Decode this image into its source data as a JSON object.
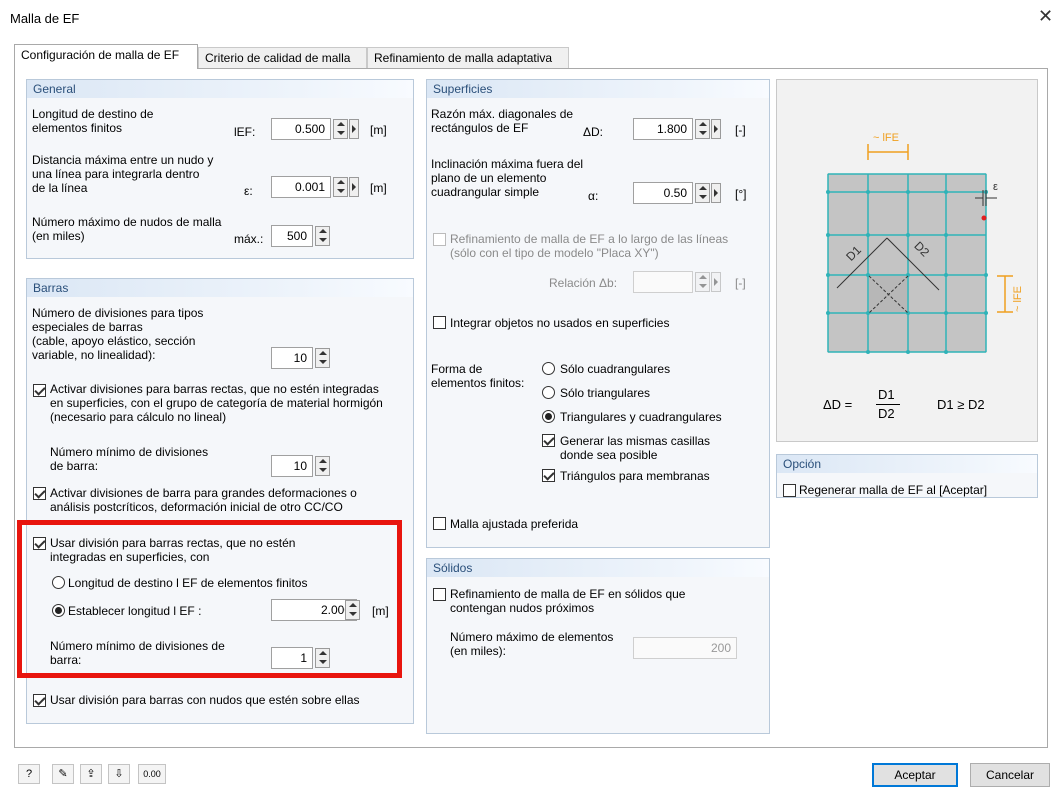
{
  "window": {
    "title": "Malla de EF"
  },
  "tabs": [
    "Configuración de malla de EF",
    "Criterio de calidad de malla",
    "Refinamiento de malla adaptativa"
  ],
  "general": {
    "header": "General",
    "target_length": {
      "label_1": "Longitud de destino de",
      "label_2": "elementos finitos",
      "symbol": "lEF:",
      "value": "0.500",
      "unit": "[m]"
    },
    "max_distance": {
      "label_1": "Distancia máxima entre un nudo y",
      "label_2": "una línea para integrarla dentro",
      "label_3": "de la línea",
      "symbol": "ε:",
      "value": "0.001",
      "unit": "[m]"
    },
    "max_nodes": {
      "label_1": "Número máximo de nudos de malla",
      "label_2": "(en miles)",
      "symbol": "máx.:",
      "value": "500"
    }
  },
  "bars": {
    "header": "Barras",
    "special_divisions": {
      "label_1": "Número de divisiones para tipos",
      "label_2": "especiales de barras",
      "label_3": "(cable, apoyo elástico, sección",
      "label_4": "variable, no linealidad):",
      "value": "10"
    },
    "activate_straight": {
      "line_1": "Activar divisiones para barras rectas, que no estén integradas",
      "line_2": "en superficies, con el grupo de categoría de material hormigón",
      "line_3": "(necesario para cálculo no lineal)",
      "checked": true
    },
    "min_divisions": {
      "label_1": "Número mínimo de divisiones",
      "label_2": "de barra:",
      "value": "10"
    },
    "activate_large": {
      "line_1": "Activar divisiones de barra para grandes deformaciones o",
      "line_2": "análisis postcríticos, deformación inicial de otro CC/CO",
      "checked": true
    },
    "use_division": {
      "line_1": "Usar división para barras rectas, que no estén",
      "line_2": "integradas en superficies, con",
      "checked": true
    },
    "radio_target": {
      "label": "Longitud de destino l EF de elementos finitos",
      "selected": false
    },
    "radio_set": {
      "label": "Establecer longitud l EF :",
      "selected": true,
      "value": "2.000",
      "unit": "[m]"
    },
    "min_div2": {
      "label_1": "Número mínimo de divisiones de",
      "label_2": "barra:",
      "value": "1"
    },
    "use_nodes": {
      "label": "Usar división para barras con nudos que estén sobre ellas",
      "checked": true
    }
  },
  "surfaces": {
    "header": "Superficies",
    "diag_ratio": {
      "label_1": "Razón máx. diagonales de",
      "label_2": "rectángulos de EF",
      "symbol": "ΔD:",
      "value": "1.800",
      "unit": "[-]"
    },
    "max_incline": {
      "label_1": "Inclinación máxima fuera del",
      "label_2": "plano de un elemento",
      "label_3": "cuadrangular simple",
      "symbol": "α:",
      "value": "0.50",
      "unit": "[°]"
    },
    "refine_lines": {
      "line_1": "Refinamiento de malla de EF a lo largo de las líneas",
      "line_2": "(sólo con el tipo de modelo \"Placa XY\")",
      "checked": false
    },
    "relation": {
      "label": "Relación Δb:",
      "value": "",
      "unit": "[-]"
    },
    "integrate_unused": {
      "label": "Integrar objetos no usados en superficies",
      "checked": false
    },
    "shape": {
      "label_1": "Forma de",
      "label_2": "elementos finitos:",
      "options": [
        "Sólo cuadrangulares",
        "Sólo triangulares",
        "Triangulares y cuadrangulares"
      ],
      "selected": 2
    },
    "same_cells": {
      "line_1": "Generar las mismas casillas",
      "line_2": "donde sea posible",
      "checked": true
    },
    "membranes": {
      "label": "Triángulos para membranas",
      "checked": true
    },
    "preferred": {
      "label": "Malla ajustada preferida",
      "checked": false
    }
  },
  "solids": {
    "header": "Sólidos",
    "refine": {
      "line_1": "Refinamiento de malla de EF en sólidos que",
      "line_2": "contengan nudos próximos",
      "checked": false
    },
    "max_elements": {
      "label_1": "Número  máximo de elementos",
      "label_2": "(en miles):",
      "value": "200"
    }
  },
  "diagram": {
    "lfe_top": "~ lFE",
    "lfe_side": "~ lFE",
    "epsilon": "ε",
    "d1": "D1",
    "d2": "D2",
    "formula_lhs": "ΔD =",
    "formula_num": "D1",
    "formula_den": "D2",
    "formula_cond": "D1 ≥ D2"
  },
  "option": {
    "header": "Opción",
    "regenerate": {
      "label": "Regenerar malla de EF al [Aceptar]",
      "checked": false
    }
  },
  "footer": {
    "tool_icons": [
      "help-icon",
      "edit-icon",
      "export-icon",
      "import-icon",
      "units-icon"
    ],
    "tool_glyphs": [
      "?",
      "✎",
      "⇪",
      "⇩",
      "0.00"
    ],
    "accept": "Aceptar",
    "cancel": "Cancelar"
  },
  "colors": {
    "accent": "#0078d7",
    "highlight": "#e8150e",
    "group_header": "#2a4f7a",
    "mesh": "#2fb3b8",
    "dim_orange": "#f0a020"
  }
}
